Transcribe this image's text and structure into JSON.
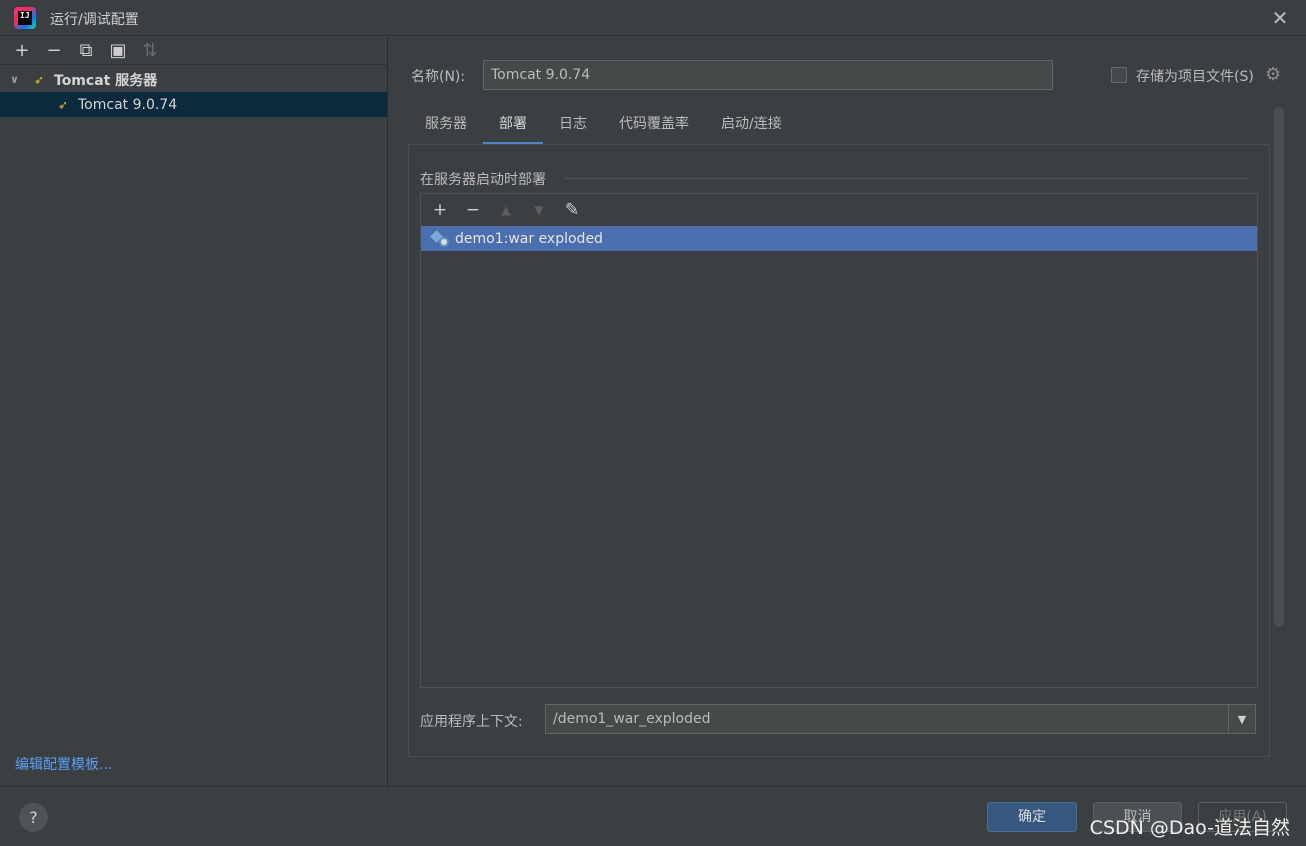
{
  "window": {
    "title": "运行/调试配置",
    "app_icon_text": "IJ",
    "close_glyph": "✕"
  },
  "left_toolbar": {
    "add": "+",
    "remove": "−",
    "copy": "⧉",
    "folder": "▣",
    "sort": "⇅"
  },
  "tree": {
    "group_label": "Tomcat 服务器",
    "child_label": "Tomcat 9.0.74",
    "chevron": "∨",
    "cat_glyph": "➶"
  },
  "edit_templates_link": "编辑配置模板...",
  "form": {
    "name_label": "名称(N):",
    "name_value": "Tomcat 9.0.74",
    "store_label": "存储为项目文件(S)",
    "gear_glyph": "⚙"
  },
  "tabs": [
    "服务器",
    "部署",
    "日志",
    "代码覆盖率",
    "启动/连接"
  ],
  "active_tab": 1,
  "deploy": {
    "section_title": "在服务器启动时部署",
    "toolbar": {
      "add": "+",
      "remove": "−",
      "up": "▲",
      "down": "▼",
      "edit": "✎"
    },
    "items": [
      "demo1:war exploded"
    ]
  },
  "context": {
    "label": "应用程序上下文:",
    "value": "/demo1_war_exploded",
    "arrow": "▼"
  },
  "buttons": {
    "help": "?",
    "ok": "确定",
    "cancel": "取消",
    "apply": "应用(A)"
  },
  "watermark": "CSDN @Dao-道法自然",
  "colors": {
    "background": "#3c3f41",
    "selection": "#4b6eaf",
    "tree_selection": "#0d293e",
    "accent_tab": "#4a88c7",
    "link": "#589df6",
    "primary_button": "#365880"
  },
  "icons": {
    "app": "intellij-icon",
    "tomcat": "tomcat-cat-icon",
    "artifact": "web-artifact-icon",
    "settings": "gear-icon"
  }
}
